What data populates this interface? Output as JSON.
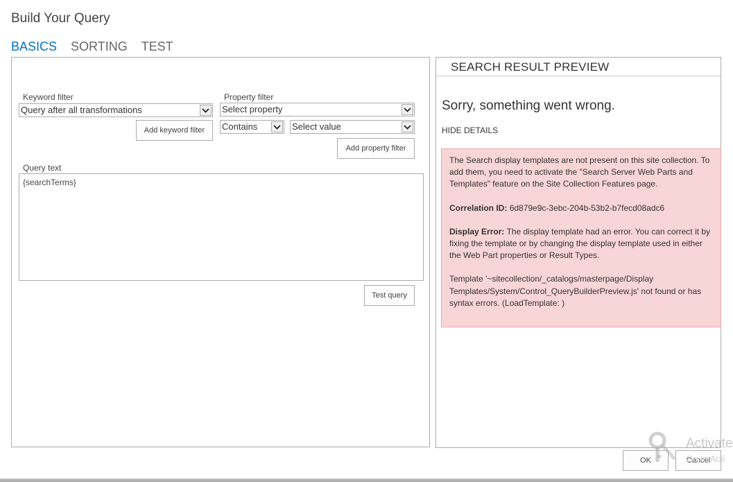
{
  "dialog": {
    "title": "Build Your Query"
  },
  "tabs": [
    {
      "label": "BASICS",
      "active": true
    },
    {
      "label": "SORTING",
      "active": false
    },
    {
      "label": "TEST",
      "active": false
    }
  ],
  "basics": {
    "keyword_filter": {
      "label": "Keyword filter",
      "selected": "Query after all transformations",
      "add_button": "Add keyword filter"
    },
    "property_filter": {
      "label": "Property filter",
      "property_selected": "Select property",
      "operator_selected": "Contains",
      "value_selected": "Select value",
      "add_button": "Add property filter"
    },
    "query_text": {
      "label": "Query text",
      "value": "{searchTerms}"
    },
    "test_button": "Test query"
  },
  "preview": {
    "header": "SEARCH RESULT PREVIEW",
    "error_heading": "Sorry, something went wrong.",
    "hide_details": "HIDE DETAILS",
    "error": {
      "message": "The Search display templates are not present on this site collection. To add them, you need to activate the \"Search Server Web Parts and Templates\" feature on the Site Collection Features page.",
      "correlation_label": "Correlation ID:",
      "correlation_id": "6d879e9c-3ebc-204b-53b2-b7fecd08adc6",
      "display_error_label": "Display Error:",
      "display_error_text": "The display template had an error. You can correct it by fixing the template or by changing the display template used in either the Web Part properties or Result Types.",
      "template_message": "Template '~sitecollection/_catalogs/masterpage/Display Templates/System/Control_QueryBuilderPreview.js' not found or has syntax errors. (LoadTemplate: )"
    }
  },
  "footer": {
    "ok_label": "OK",
    "cancel_label": "Cancel"
  },
  "watermark": {
    "title": "Activate",
    "subtitle": "Go to Acti",
    "icon": "key-icon"
  },
  "colors": {
    "accent": "#0072c6",
    "error_bg": "#f8d5d6",
    "error_border": "#eca8aa"
  }
}
